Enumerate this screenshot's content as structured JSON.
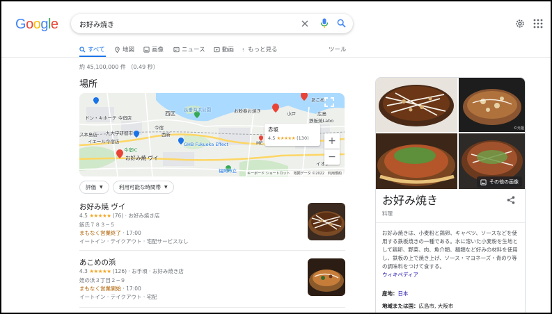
{
  "logo": {
    "text": "Google",
    "colors": [
      "#4285F4",
      "#EA4335",
      "#FBBC05",
      "#4285F4",
      "#34A853",
      "#EA4335"
    ]
  },
  "search": {
    "query": "お好み焼き",
    "icons": [
      "close-icon",
      "mic-icon",
      "search-icon"
    ]
  },
  "header_icons": [
    "settings-gear-icon",
    "apps-grid-icon"
  ],
  "tabs": [
    {
      "label": "すべて",
      "icon": "search-icon",
      "active": true
    },
    {
      "label": "地図",
      "icon": "map-pin-icon",
      "active": false
    },
    {
      "label": "画像",
      "icon": "image-icon",
      "active": false
    },
    {
      "label": "ニュース",
      "icon": "news-icon",
      "active": false
    },
    {
      "label": "動画",
      "icon": "video-icon",
      "active": false
    },
    {
      "label": "もっと見る",
      "icon": "more-vert-icon",
      "active": false
    }
  ],
  "tools_label": "ツール",
  "result_stats": "約 45,100,000 件 （0.49 秒）",
  "places_heading": "場所",
  "map": {
    "labels": [
      "長垂海浜公園",
      "ドン・キホーテ 今宿店",
      "九大学研都市",
      "西区",
      "今宿",
      "イエール今宿店",
      "ス本島店",
      "西新",
      "お粉春お焼き",
      "鉄板焼Labo",
      "あこめ",
      "広島",
      "福岡市立",
      "GHB Fukuoka Effect",
      "ME",
      "イオン",
      "お好み焼 ヴイ",
      "今宿IC",
      "小戸"
    ],
    "card": {
      "name": "赤坂",
      "rating": "4.5",
      "stars": "★★★★★",
      "count": "(130)"
    },
    "credit": "キーボード ショートカット　地図データ ©2022　利用規約",
    "buttons": [
      "+",
      "−"
    ],
    "fullscreen_icon": "fullscreen-icon"
  },
  "filters": [
    "評価",
    "利用可能な時間帯"
  ],
  "places": [
    {
      "name": "お好み焼 ヴイ",
      "rating": "4.5",
      "stars": "★★★★★",
      "meta": "(76) · お好み焼き店",
      "address": "飯氏７８３−５",
      "status": "まもなく営業終了",
      "status_time": " · 17:00",
      "services": "イートイン · テイクアウト · 宅配サービスなし"
    },
    {
      "name": "あこめの浜",
      "rating": "4.3",
      "stars": "★★★★★",
      "meta": "(126) · お手頃 · お好み焼き店",
      "address": "姪の浜３丁目２−９",
      "status": "まもなく営業開始",
      "status_time": " · 17:00",
      "services": "イートイン · テイクアウト · 宅配"
    }
  ],
  "knowledge_panel": {
    "title": "お好み焼き",
    "subtitle": "料理",
    "more_images": "その他の画像",
    "image_credit": "©元祖",
    "description": "お好み焼きは、小麦粉と鶏卵、キャベツ、ソースなどを使用する鉄板焼きの一種である。水に溶いた小麦粉を生地として鶏卵、野菜、肉、魚介類、麺類など好みの材料を使用し、鉄板の上で焼き上げ、ソース・マヨネーズ・青のり等の調味料をつけて食する。",
    "source": "ウィキペディア",
    "facts": [
      {
        "label": "産地：",
        "value": "日本"
      },
      {
        "label": "地域または国：",
        "value": "広島市, 大阪市"
      }
    ]
  },
  "colors": {
    "accent_blue": "#1a73e8",
    "link": "#1a0dab",
    "star": "#f5a623",
    "status_orange": "#b06000",
    "muted": "#70757a"
  }
}
